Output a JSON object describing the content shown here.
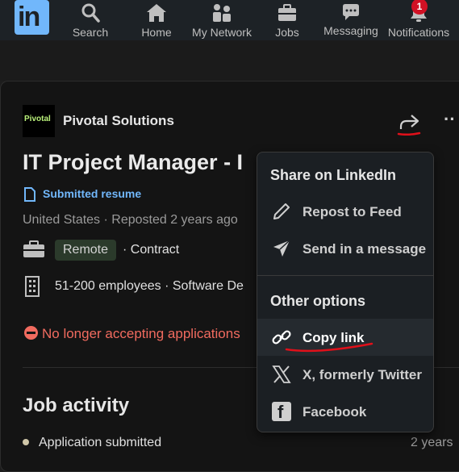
{
  "nav": {
    "logo_text": "in",
    "notification_count": "1",
    "items": [
      {
        "label": "Search",
        "icon": "search-icon"
      },
      {
        "label": "Home",
        "icon": "home-icon"
      },
      {
        "label": "My Network",
        "icon": "my-network-icon"
      },
      {
        "label": "Jobs",
        "icon": "jobs-icon"
      },
      {
        "label": "Messaging",
        "icon": "messaging-icon"
      },
      {
        "label": "Notifications",
        "icon": "bell-icon"
      }
    ]
  },
  "job": {
    "company_logo_text": "Pivotal",
    "company": "Pivotal Solutions",
    "title": "IT Project Manager - I",
    "application_status": "Submitted resume",
    "location": "United States · Reposted 2 years ago",
    "workplace": "Remote",
    "job_type": "· Contract",
    "company_size": "51-200 employees · Software De",
    "closed_notice": "No longer accepting applications"
  },
  "activity": {
    "title": "Job activity",
    "items": [
      {
        "label": "Application submitted",
        "time": "2 years"
      }
    ]
  },
  "share_menu": {
    "heading_linkedin": "Share on LinkedIn",
    "repost": "Repost to Feed",
    "send_message": "Send in a message",
    "heading_other": "Other options",
    "copy_link": "Copy link",
    "twitter": "X, formerly Twitter",
    "facebook": "Facebook",
    "facebook_glyph": "f"
  },
  "colors": {
    "accent_blue": "#71b7fb",
    "error_red": "#f16b5f",
    "annotation_red": "#e0101a",
    "background": "#141414"
  }
}
